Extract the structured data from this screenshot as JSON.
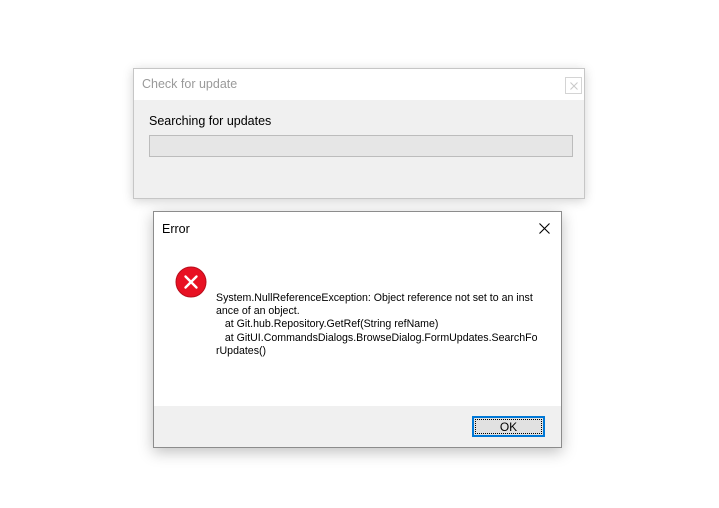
{
  "update_dialog": {
    "title": "Check for update",
    "status": "Searching for updates",
    "progress": 0
  },
  "error_dialog": {
    "title": "Error",
    "icon": "error-icon",
    "message": "System.NullReferenceException: Object reference not set to an instance of an object.\n   at Git.hub.Repository.GetRef(String refName)\n   at GitUI.CommandsDialogs.BrowseDialog.FormUpdates.SearchForUpdates()",
    "ok_label": "OK"
  },
  "colors": {
    "error_red": "#e81123",
    "focus_blue": "#0078d7"
  }
}
